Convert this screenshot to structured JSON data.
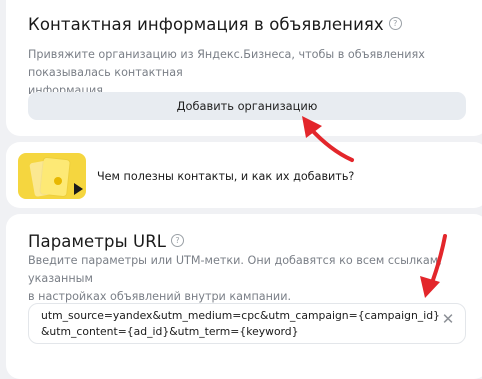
{
  "contact_section": {
    "title": "Контактная информация в объявлениях",
    "help_icon": "question-circle-icon",
    "description_line1": "Привяжите организацию из Яндекс.Бизнеса, чтобы в объявлениях показывалась контактная",
    "description_line2": "информация",
    "add_button_label": "Добавить организацию"
  },
  "promo": {
    "thumbnail_icon": "video-thumbnail-icon",
    "text": "Чем полезны контакты, и как их добавить?"
  },
  "url_section": {
    "title": "Параметры URL",
    "help_icon": "question-circle-icon",
    "description_line1": "Введите параметры или UTM-метки. Они добавятся ко всем ссылкам, указанным",
    "description_line2": "в настройках объявлений внутри кампании.",
    "input_value": "utm_source=yandex&utm_medium=cpc&utm_campaign={campaign_id}&utm_content={ad_id}&utm_term={keyword}",
    "clear_icon": "close-icon"
  },
  "colors": {
    "background": "#f0f1f4",
    "card": "#ffffff",
    "button": "#e8ecf1",
    "annotation_arrow": "#e3262b",
    "thumbnail": "#f5d63f"
  }
}
